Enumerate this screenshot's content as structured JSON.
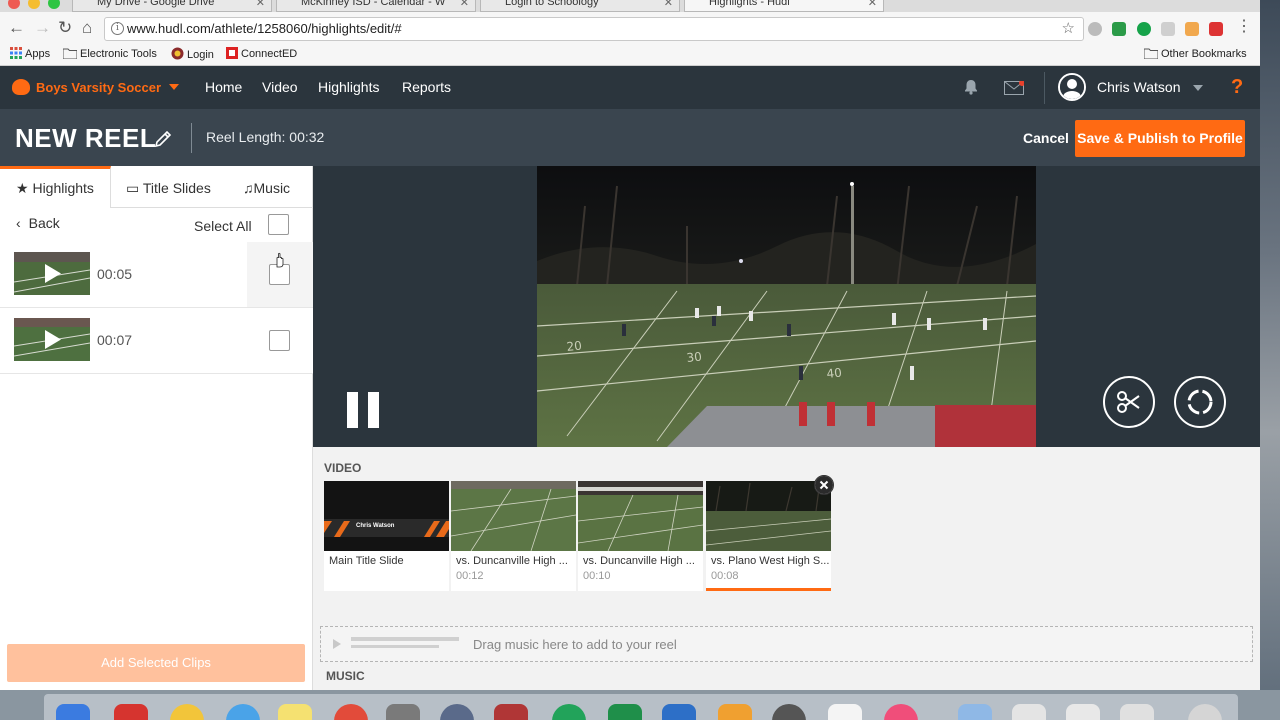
{
  "browser": {
    "tabs": [
      {
        "title": "My Drive - Google Drive"
      },
      {
        "title": "McKinney ISD - Calendar - W"
      },
      {
        "title": "Login to Schoology"
      },
      {
        "title": "Highlights - Hudl",
        "active": true
      }
    ],
    "url": "www.hudl.com/athlete/1258060/highlights/edit/#",
    "bookmarks": [
      "Apps",
      "Electronic Tools",
      "Login",
      "ConnectED"
    ],
    "other_bookmarks": "Other Bookmarks"
  },
  "topnav": {
    "team": "Boys Varsity Soccer",
    "links": [
      "Home",
      "Video",
      "Highlights",
      "Reports"
    ],
    "user": "Chris Watson",
    "help": "?"
  },
  "reel": {
    "title": "NEW REEL",
    "length": "Reel Length: 00:32",
    "cancel": "Cancel",
    "publish": "Save & Publish to Profile"
  },
  "left": {
    "tabs": [
      "Highlights",
      "Title Slides",
      "Music"
    ],
    "back": "Back",
    "select_all": "Select All",
    "clips": [
      {
        "duration": "00:05"
      },
      {
        "duration": "00:07"
      }
    ],
    "add_button": "Add Selected Clips"
  },
  "timeline": {
    "video_label": "VIDEO",
    "music_label": "MUSIC",
    "clips": [
      {
        "title": "Main Title Slide",
        "time": "",
        "slide_name": "Chris Watson"
      },
      {
        "title": "vs. Duncanville High ...",
        "time": "00:12"
      },
      {
        "title": "vs. Duncanville High ...",
        "time": "00:10"
      },
      {
        "title": "vs. Plano West High S...",
        "time": "00:08"
      }
    ],
    "music_hint": "Drag music here to add to your reel"
  },
  "colors": {
    "accent": "#ff6a13",
    "nav_bg": "#2b353d",
    "reelbar_bg": "#3a454f"
  }
}
